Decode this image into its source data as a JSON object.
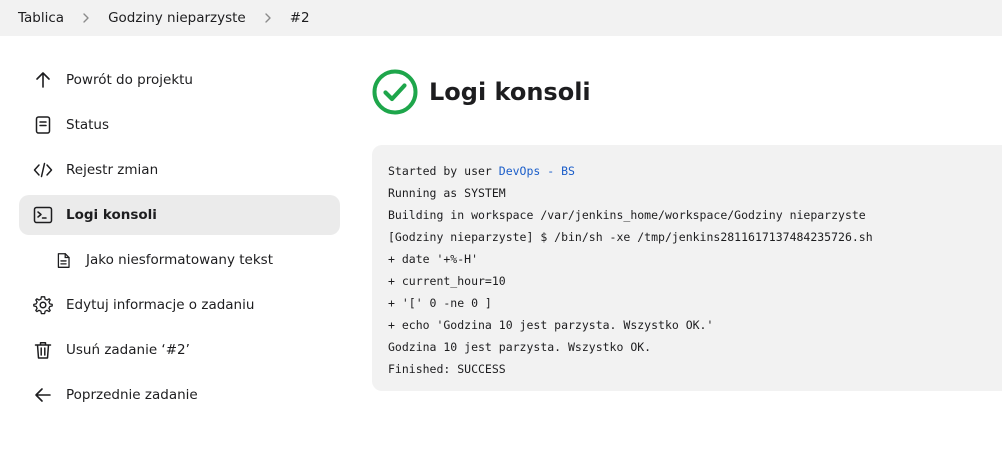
{
  "breadcrumb": {
    "items": [
      "Tablica",
      "Godziny nieparzyste",
      "#2"
    ]
  },
  "sidebar": {
    "items": [
      {
        "label": "Powrót do projektu",
        "icon": "arrow-up-icon"
      },
      {
        "label": "Status",
        "icon": "document-icon"
      },
      {
        "label": "Rejestr zmian",
        "icon": "code-icon"
      },
      {
        "label": "Logi konsoli",
        "icon": "terminal-icon",
        "active": true
      },
      {
        "label": "Jako niesformatowany tekst",
        "icon": "text-file-icon",
        "sub": true
      },
      {
        "label": "Edytuj informacje o zadaniu",
        "icon": "gear-icon"
      },
      {
        "label": "Usuń zadanie ‘#2’",
        "icon": "trash-icon"
      },
      {
        "label": "Poprzednie zadanie",
        "icon": "arrow-left-icon"
      }
    ]
  },
  "main": {
    "title": "Logi konsoli",
    "status_icon": "success-check-icon",
    "status_color": "#1ea64b"
  },
  "console": {
    "started_prefix": "Started by user ",
    "started_user": "DevOps - BS",
    "lines": [
      "Running as SYSTEM",
      "Building in workspace /var/jenkins_home/workspace/Godziny nieparzyste",
      "[Godziny nieparzyste] $ /bin/sh -xe /tmp/jenkins2811617137484235726.sh",
      "+ date '+%-H'",
      "+ current_hour=10",
      "+ '[' 0 -ne 0 ]",
      "+ echo 'Godzina 10 jest parzysta. Wszystko OK.'",
      "Godzina 10 jest parzysta. Wszystko OK.",
      "Finished: SUCCESS"
    ]
  },
  "colors": {
    "accent_link": "#1a5dc9",
    "success": "#1ea64b"
  }
}
